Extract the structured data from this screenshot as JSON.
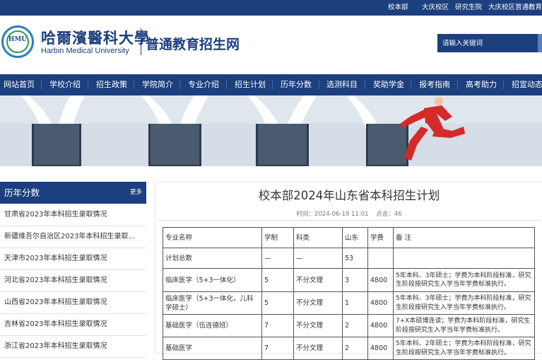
{
  "topbar": {
    "links": [
      "校本部",
      "大庆校区",
      "研究生院",
      "大庆校区普通教育"
    ]
  },
  "header": {
    "logo_text": "HMU",
    "university_cn": "哈爾濱醫科大學",
    "university_en": "Harbin Medical University",
    "site_title": "普通教育招生网",
    "search_placeholder": "请输入关键词"
  },
  "nav": {
    "items": [
      "网站首页",
      "学校介绍",
      "招生政策",
      "学院简介",
      "专业介绍",
      "招生计划",
      "历年分数",
      "选测科目",
      "奖助学金",
      "报考指南",
      "高考助力",
      "招宣动态"
    ]
  },
  "colors": {
    "brand": "#1c3f7d",
    "accent_red": "#d42a2a"
  },
  "sidebar": {
    "title": "历年分数",
    "more": "更多",
    "items": [
      "甘肃省2023年本科招生录取情况",
      "新疆维吾尔自治区2023年本科招生录取...",
      "天津市2023年本科招生录取情况",
      "河北省2023年本科招生录取情况",
      "山西省2023年本科招生录取情况",
      "吉林省2023年本科招生录取情况",
      "浙江省2023年本科招生录取情况"
    ]
  },
  "article": {
    "title": "校本部2024年山东省本科招生计划",
    "time_label": "时间：2024-06-19 11:01",
    "clicks_label": "点击：46",
    "table": {
      "headers": [
        "专业名称",
        "学制",
        "科类",
        "山东",
        "学费",
        "备 注"
      ],
      "rows": [
        [
          "计划总数",
          "—",
          "—",
          "53",
          "",
          ""
        ],
        [
          "临床医学（5+3一体化）",
          "5",
          "不分文理",
          "3",
          "4800",
          "5年本科、3年硕士；学费为本科阶段标准，研究生阶段按研究生入学当年学费标准执行。"
        ],
        [
          "临床医学（5+3一体化，儿科学硕士）",
          "5",
          "不分文理",
          "1",
          "4800",
          "5年本科、3年硕士；学费为本科阶段标准，研究生阶段按研究生入学当年学费标准执行。"
        ],
        [
          "基础医学（伍连德班）",
          "7",
          "不分文理",
          "2",
          "4800",
          "7+X本硕博连读；学费为本科阶段标准，研究生阶段按研究生入学当年学费标准执行。"
        ],
        [
          "基础医学",
          "7",
          "不分文理",
          "2",
          "4800",
          "5年本科、2年硕士；学费为本科阶段标准，研究生阶段按研究生入学当年学费标准执行。"
        ]
      ]
    }
  }
}
